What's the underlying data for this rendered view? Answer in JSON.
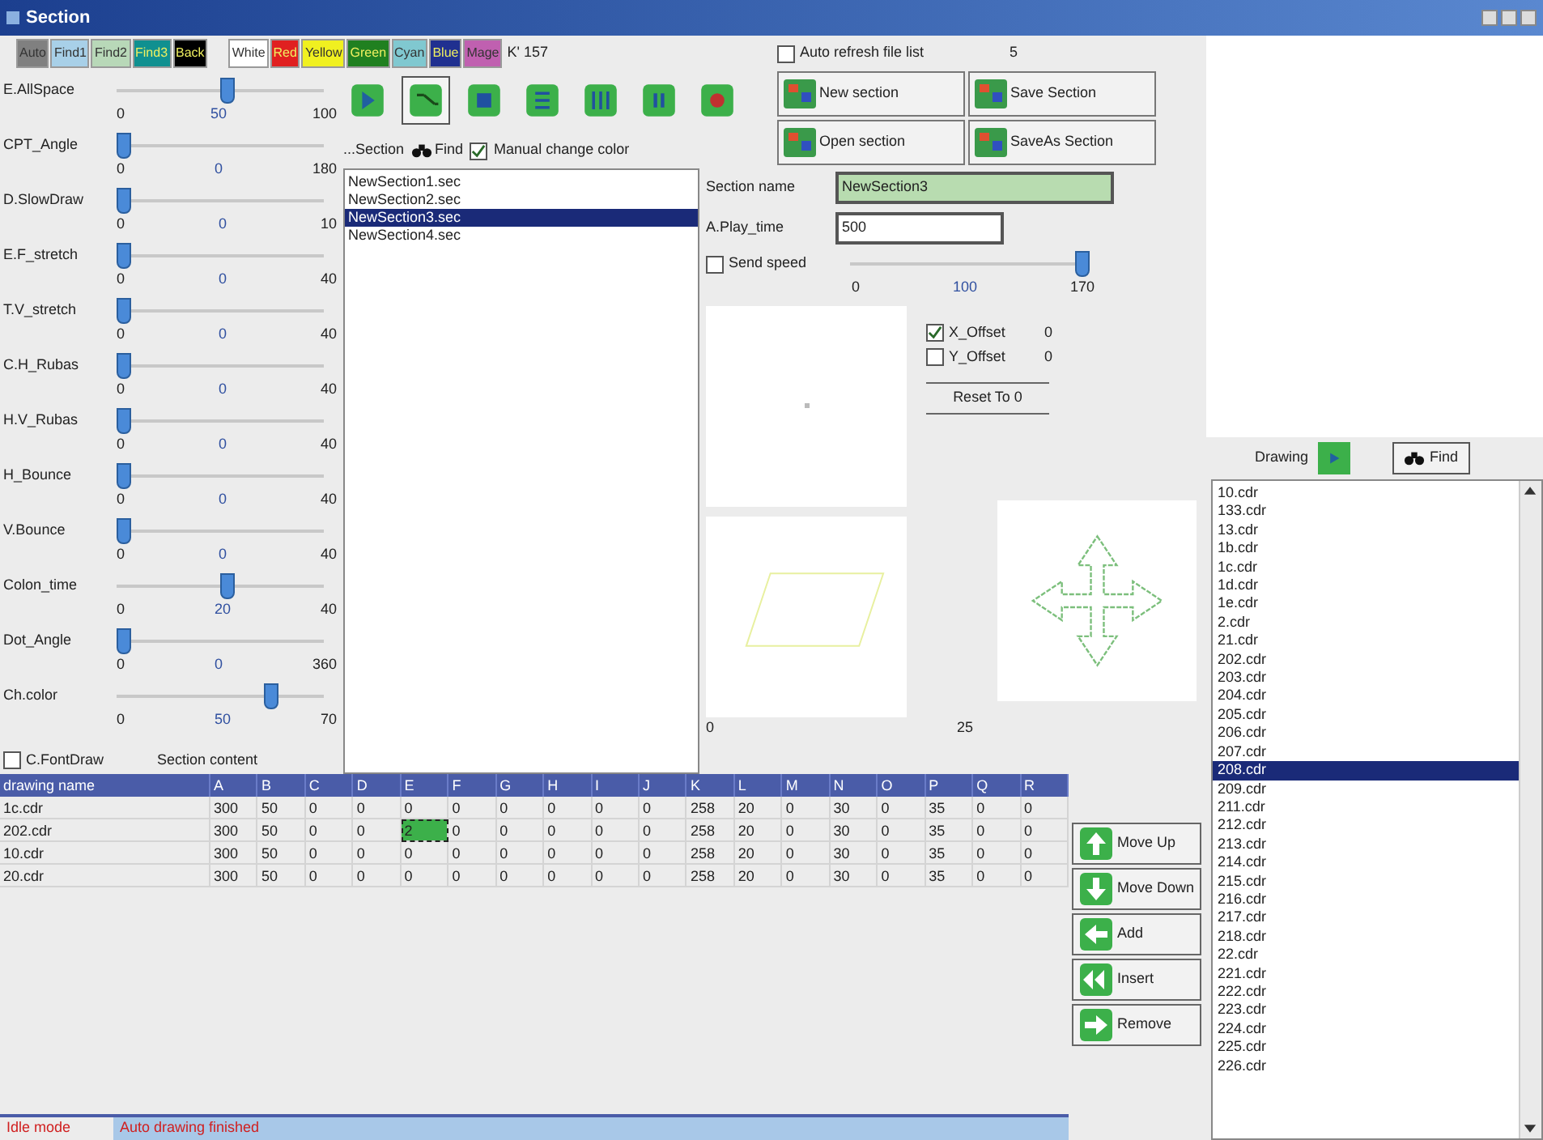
{
  "window": {
    "title": "Section"
  },
  "color_buttons": [
    {
      "label": "Auto",
      "color": "#808080"
    },
    {
      "label": "Find1",
      "color": "#a8d0e8"
    },
    {
      "label": "Find2",
      "color": "#b8d8b8"
    },
    {
      "label": "Find3",
      "color": "#109090"
    },
    {
      "label": "Back",
      "color": "#000000"
    },
    {
      "label": "White",
      "color": "#ffffff"
    },
    {
      "label": "Red",
      "color": "#e02020"
    },
    {
      "label": "Yellow",
      "color": "#f0f020"
    },
    {
      "label": "Green",
      "color": "#208020"
    },
    {
      "label": "Cyan",
      "color": "#80c8d0"
    },
    {
      "label": "Blue",
      "color": "#203090"
    },
    {
      "label": "Mage",
      "color": "#c060b0"
    }
  ],
  "color_counter": "K' 157",
  "sliders": [
    {
      "label": "E.AllSpace",
      "min": "0",
      "value": "50",
      "max": "100",
      "level": 0.5
    },
    {
      "label": "CPT_Angle",
      "min": "0",
      "value": "0",
      "max": "180",
      "level": 0
    },
    {
      "label": "D.SlowDraw",
      "min": "0",
      "value": "0",
      "max": "10",
      "level": 0
    },
    {
      "label": "E.F_stretch",
      "min": "0",
      "value": "0",
      "max": "40",
      "level": 0
    },
    {
      "label": "T.V_stretch",
      "min": "0",
      "value": "0",
      "max": "40",
      "level": 0
    },
    {
      "label": "C.H_Rubas",
      "min": "0",
      "value": "0",
      "max": "40",
      "level": 0
    },
    {
      "label": "H.V_Rubas",
      "min": "0",
      "value": "0",
      "max": "40",
      "level": 0
    },
    {
      "label": "H_Bounce",
      "min": "0",
      "value": "0",
      "max": "40",
      "level": 0
    },
    {
      "label": "V.Bounce",
      "min": "0",
      "value": "0",
      "max": "40",
      "level": 0
    },
    {
      "label": "Colon_time",
      "min": "0",
      "value": "20",
      "max": "40",
      "level": 0.5
    },
    {
      "label": "Dot_Angle",
      "min": "0",
      "value": "0",
      "max": "360",
      "level": 0
    },
    {
      "label": "Ch.color",
      "min": "0",
      "value": "50",
      "max": "70",
      "level": 0.72
    }
  ],
  "font_draw": {
    "label": "C.FontDraw",
    "checked": false
  },
  "section_content": "Section content",
  "toolbar": [
    {
      "kind": "play",
      "selected": false
    },
    {
      "kind": "draw",
      "selected": true
    },
    {
      "kind": "square",
      "selected": false
    },
    {
      "kind": "lines",
      "selected": false
    },
    {
      "kind": "columns",
      "selected": false
    },
    {
      "kind": "pause",
      "selected": false
    },
    {
      "kind": "record",
      "selected": false
    }
  ],
  "section_tools": {
    "prefix": "...Section",
    "find": "Find",
    "manual_change_color": {
      "label": "Manual change color",
      "checked": true
    }
  },
  "section_files": [
    {
      "name": "NewSection1.sec",
      "selected": false
    },
    {
      "name": "NewSection2.sec",
      "selected": false
    },
    {
      "name": "NewSection3.sec",
      "selected": true
    },
    {
      "name": "NewSection4.sec",
      "selected": false
    }
  ],
  "auto_refresh": {
    "label": "Auto refresh file list",
    "checked": false
  },
  "refresh_count": "5",
  "file_buttons": [
    "New section",
    "Save Section",
    "Open section",
    "SaveAs Section"
  ],
  "section_name": {
    "label": "Section name",
    "value": "NewSection3"
  },
  "play_time": {
    "label": "A.Play_time",
    "value": "500"
  },
  "send_speed": {
    "label": "Send speed",
    "checked": false,
    "min": "0",
    "mid": "100",
    "max": "170",
    "level": 1
  },
  "offsets": [
    {
      "label": "X_Offset",
      "value": "0",
      "checked": true
    },
    {
      "label": "Y_Offset",
      "value": "0",
      "checked": false
    }
  ],
  "reset_button": "Reset To 0",
  "preview_labels": [
    "0",
    "25"
  ],
  "table": {
    "columns": [
      "drawing name",
      "A",
      "B",
      "C",
      "D",
      "E",
      "F",
      "G",
      "H",
      "I",
      "J",
      "K",
      "L",
      "M",
      "N",
      "O",
      "P",
      "Q",
      "R"
    ],
    "rows": [
      [
        {
          "v": "1c.cdr",
          "selected": false
        },
        {
          "v": "300",
          "selected": false
        },
        {
          "v": "50",
          "selected": false
        },
        {
          "v": "0",
          "selected": false
        },
        {
          "v": "0",
          "selected": false
        },
        {
          "v": "0",
          "selected": false
        },
        {
          "v": "0",
          "selected": false
        },
        {
          "v": "0",
          "selected": false
        },
        {
          "v": "0",
          "selected": false
        },
        {
          "v": "0",
          "selected": false
        },
        {
          "v": "0",
          "selected": false
        },
        {
          "v": "258",
          "selected": false
        },
        {
          "v": "20",
          "selected": false
        },
        {
          "v": "0",
          "selected": false
        },
        {
          "v": "30",
          "selected": false
        },
        {
          "v": "0",
          "selected": false
        },
        {
          "v": "35",
          "selected": false
        },
        {
          "v": "0",
          "selected": false
        },
        {
          "v": "0",
          "selected": false
        }
      ],
      [
        {
          "v": "202.cdr",
          "selected": false
        },
        {
          "v": "300",
          "selected": false
        },
        {
          "v": "50",
          "selected": false
        },
        {
          "v": "0",
          "selected": false
        },
        {
          "v": "0",
          "selected": false
        },
        {
          "v": "2",
          "selected": true
        },
        {
          "v": "0",
          "selected": false
        },
        {
          "v": "0",
          "selected": false
        },
        {
          "v": "0",
          "selected": false
        },
        {
          "v": "0",
          "selected": false
        },
        {
          "v": "0",
          "selected": false
        },
        {
          "v": "258",
          "selected": false
        },
        {
          "v": "20",
          "selected": false
        },
        {
          "v": "0",
          "selected": false
        },
        {
          "v": "30",
          "selected": false
        },
        {
          "v": "0",
          "selected": false
        },
        {
          "v": "35",
          "selected": false
        },
        {
          "v": "0",
          "selected": false
        },
        {
          "v": "0",
          "selected": false
        }
      ],
      [
        {
          "v": "10.cdr",
          "selected": false
        },
        {
          "v": "300",
          "selected": false
        },
        {
          "v": "50",
          "selected": false
        },
        {
          "v": "0",
          "selected": false
        },
        {
          "v": "0",
          "selected": false
        },
        {
          "v": "0",
          "selected": false
        },
        {
          "v": "0",
          "selected": false
        },
        {
          "v": "0",
          "selected": false
        },
        {
          "v": "0",
          "selected": false
        },
        {
          "v": "0",
          "selected": false
        },
        {
          "v": "0",
          "selected": false
        },
        {
          "v": "258",
          "selected": false
        },
        {
          "v": "20",
          "selected": false
        },
        {
          "v": "0",
          "selected": false
        },
        {
          "v": "30",
          "selected": false
        },
        {
          "v": "0",
          "selected": false
        },
        {
          "v": "35",
          "selected": false
        },
        {
          "v": "0",
          "selected": false
        },
        {
          "v": "0",
          "selected": false
        }
      ],
      [
        {
          "v": "20.cdr",
          "selected": false
        },
        {
          "v": "300",
          "selected": false
        },
        {
          "v": "50",
          "selected": false
        },
        {
          "v": "0",
          "selected": false
        },
        {
          "v": "0",
          "selected": false
        },
        {
          "v": "0",
          "selected": false
        },
        {
          "v": "0",
          "selected": false
        },
        {
          "v": "0",
          "selected": false
        },
        {
          "v": "0",
          "selected": false
        },
        {
          "v": "0",
          "selected": false
        },
        {
          "v": "0",
          "selected": false
        },
        {
          "v": "258",
          "selected": false
        },
        {
          "v": "20",
          "selected": false
        },
        {
          "v": "0",
          "selected": false
        },
        {
          "v": "30",
          "selected": false
        },
        {
          "v": "0",
          "selected": false
        },
        {
          "v": "35",
          "selected": false
        },
        {
          "v": "0",
          "selected": false
        },
        {
          "v": "0",
          "selected": false
        }
      ]
    ]
  },
  "move_buttons": [
    {
      "label": "Move Up",
      "kind": "up"
    },
    {
      "label": "Move Down",
      "kind": "down"
    },
    {
      "label": "Add",
      "kind": "add"
    },
    {
      "label": "Insert",
      "kind": "insert"
    },
    {
      "label": "Remove",
      "kind": "remove"
    }
  ],
  "drawing_panel": {
    "label": "Drawing",
    "find": "Find",
    "files": [
      {
        "name": "10.cdr",
        "selected": false
      },
      {
        "name": "133.cdr",
        "selected": false
      },
      {
        "name": "13.cdr",
        "selected": false
      },
      {
        "name": "1b.cdr",
        "selected": false
      },
      {
        "name": "1c.cdr",
        "selected": false
      },
      {
        "name": "1d.cdr",
        "selected": false
      },
      {
        "name": "1e.cdr",
        "selected": false
      },
      {
        "name": "2.cdr",
        "selected": false
      },
      {
        "name": "21.cdr",
        "selected": false
      },
      {
        "name": "202.cdr",
        "selected": false
      },
      {
        "name": "203.cdr",
        "selected": false
      },
      {
        "name": "204.cdr",
        "selected": false
      },
      {
        "name": "205.cdr",
        "selected": false
      },
      {
        "name": "206.cdr",
        "selected": false
      },
      {
        "name": "207.cdr",
        "selected": false
      },
      {
        "name": "208.cdr",
        "selected": true
      },
      {
        "name": "209.cdr",
        "selected": false
      },
      {
        "name": "211.cdr",
        "selected": false
      },
      {
        "name": "212.cdr",
        "selected": false
      },
      {
        "name": "213.cdr",
        "selected": false
      },
      {
        "name": "214.cdr",
        "selected": false
      },
      {
        "name": "215.cdr",
        "selected": false
      },
      {
        "name": "216.cdr",
        "selected": false
      },
      {
        "name": "217.cdr",
        "selected": false
      },
      {
        "name": "218.cdr",
        "selected": false
      },
      {
        "name": "22.cdr",
        "selected": false
      },
      {
        "name": "221.cdr",
        "selected": false
      },
      {
        "name": "222.cdr",
        "selected": false
      },
      {
        "name": "223.cdr",
        "selected": false
      },
      {
        "name": "224.cdr",
        "selected": false
      },
      {
        "name": "225.cdr",
        "selected": false
      },
      {
        "name": "226.cdr",
        "selected": false
      }
    ]
  },
  "status_bar": {
    "mode": "Idle mode",
    "message": "Auto drawing finished"
  }
}
